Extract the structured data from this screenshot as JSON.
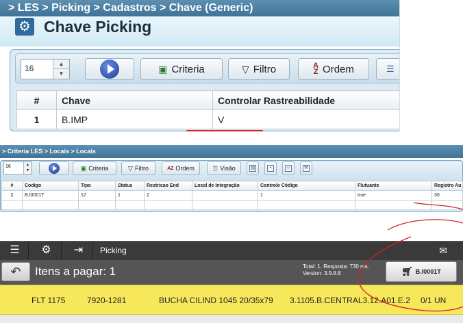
{
  "panel1": {
    "breadcrumb": "> LES > Picking > Cadastros > Chave (Generic)",
    "title": "Chave Picking",
    "spinner_value": "16",
    "buttons": {
      "criteria": "Criteria",
      "filtro": "Filtro",
      "ordem": "Ordem"
    },
    "table": {
      "headers": [
        "#",
        "Chave",
        "Controlar Rastreabilidade"
      ],
      "rows": [
        [
          "1",
          "B.IMP",
          "V"
        ]
      ]
    }
  },
  "panel2": {
    "breadcrumb": "> Criteria LES > Locais > Locais",
    "spinner_value": "16",
    "buttons": {
      "criteria": "Criteria",
      "filtro": "Filtro",
      "ordem": "Ordem",
      "visao": "Visão"
    },
    "table": {
      "headers": [
        "#",
        "Codigo",
        "Tipo",
        "Status",
        "Restricao End",
        "Local de Integração",
        "Controle Código",
        "Flutuante",
        "Registro Au"
      ],
      "rows": [
        [
          "1",
          "B.I0001T",
          "12",
          "1",
          "2",
          "",
          "1",
          "true",
          "30"
        ]
      ]
    }
  },
  "panel3": {
    "app_title": "Picking",
    "items_label": "Itens a pagar: 1",
    "stats_line1": "Total: 1. Resposta: 730 ms.",
    "stats_line2": "Version: 3.9.8.8",
    "cart_label": "B.I0001T",
    "row": {
      "col1": "FLT 1175",
      "col2": "7920-1281",
      "col3": "BUCHA CILIND 1045 20/35x79",
      "col4": "3.1105.B.CENTRAL3.12.A01.E.2",
      "col5": "0/1 UN"
    }
  },
  "colors": {
    "header_blue": "#4a80a5",
    "row_yellow": "#f7e75a",
    "annotation_red": "#d82020"
  }
}
